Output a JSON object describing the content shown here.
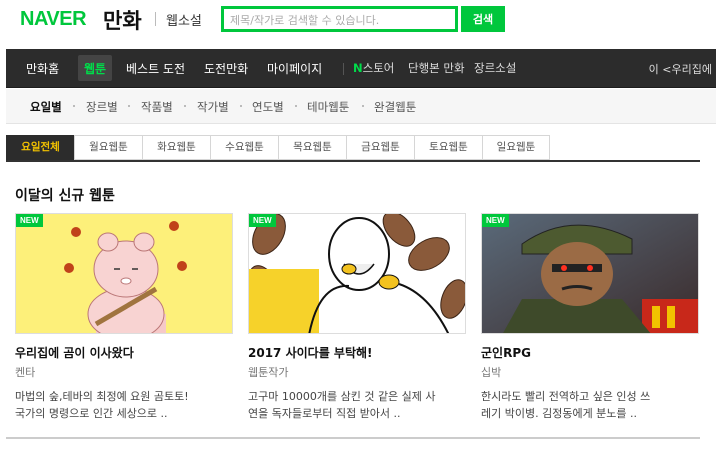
{
  "header": {
    "logo": "NAVER",
    "service": "만화",
    "webnovel_link": "웹소설",
    "search_placeholder": "제목/작가로 검색할 수 있습니다.",
    "search_button": "검색"
  },
  "gnb": {
    "items": [
      "만화홈",
      "웹툰",
      "베스트 도전",
      "도전만화",
      "마이페이지"
    ],
    "active_index": 1,
    "store_n": "N",
    "store_label": "스토어",
    "extra": [
      "단행본 만화",
      "장르소설"
    ],
    "right_text": "이 <우리집에"
  },
  "subnav": {
    "items": [
      "요일별",
      "장르별",
      "작품별",
      "작가별",
      "연도별",
      "테마웹툰",
      "완결웹툰"
    ],
    "active_index": 0
  },
  "day_tabs": {
    "items": [
      "요일전체",
      "월요웹툰",
      "화요웹툰",
      "수요웹툰",
      "목요웹툰",
      "금요웹툰",
      "토요웹툰",
      "일요웹툰"
    ],
    "active_index": 0
  },
  "section_title": "이달의 신규 웹툰",
  "badge_text": "NEW",
  "cards": [
    {
      "title": "우리집에 곰이 이사왔다",
      "author": "켄타",
      "desc_line1": "마법의 숲,테바의 최정예 요원 곰토토!",
      "desc_line2": "국가의 명령으로 인간 세상으로 .."
    },
    {
      "title": "2017 사이다를 부탁해!",
      "author": "웹툰작가",
      "desc_line1": "고구마 10000개를 삼킨 것 같은 실제 사",
      "desc_line2": "연을 독자들로부터 직접 받아서 .."
    },
    {
      "title": "군인RPG",
      "author": "십박",
      "desc_line1": "한시라도 빨리 전역하고 싶은 인성 쓰",
      "desc_line2": "레기 박이병. 김정동에게 분노를 .."
    }
  ]
}
